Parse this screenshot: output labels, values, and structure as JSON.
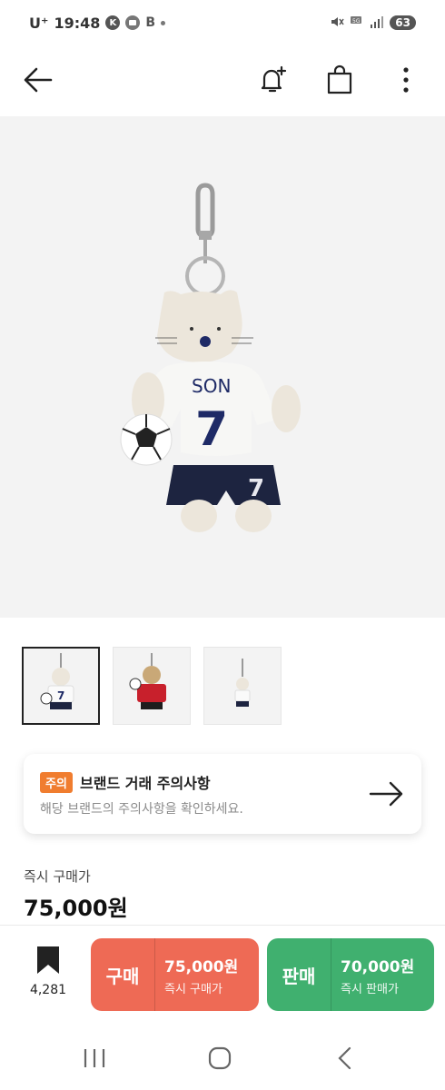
{
  "status_bar": {
    "carrier": "U⁺",
    "time": "19:48",
    "app_badges": [
      "K",
      "B"
    ],
    "battery": "63"
  },
  "topnav": {
    "icons": [
      "back-arrow-icon",
      "alert-add-icon",
      "shopping-bag-icon",
      "more-vertical-icon"
    ]
  },
  "product": {
    "jersey_name": "SON",
    "jersey_number": "7",
    "thumbnails": [
      "white-kit",
      "red-kit",
      "white-kit-small"
    ]
  },
  "notice": {
    "tag": "주의",
    "title": "브랜드 거래 주의사항",
    "subtitle": "해당 브랜드의 주의사항을 확인하세요."
  },
  "price": {
    "label": "즉시 구매가",
    "value": "75,000원"
  },
  "bottom_bar": {
    "bookmark_count": "4,281",
    "buy": {
      "label": "구매",
      "price": "75,000원",
      "sub": "즉시 구매가"
    },
    "sell": {
      "label": "판매",
      "price": "70,000원",
      "sub": "즉시 판매가"
    }
  },
  "colors": {
    "buy": "#ee6a55",
    "sell": "#40b06f",
    "notice_tag": "#f07d2f",
    "hero_bg": "#f3f3f3"
  }
}
